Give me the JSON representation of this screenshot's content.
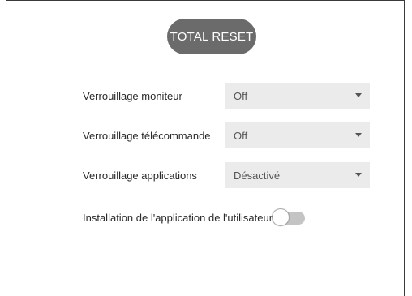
{
  "reset_button": {
    "label": "TOTAL RESET"
  },
  "settings": [
    {
      "label": "Verrouillage moniteur",
      "value": "Off"
    },
    {
      "label": "Verrouillage télécommande",
      "value": "Off"
    },
    {
      "label": "Verrouillage applications",
      "value": "Désactivé"
    }
  ],
  "user_app_install": {
    "label": "Installation de l'application de l'utilisateur",
    "enabled": false
  },
  "colors": {
    "button_bg": "#6b6b6b",
    "select_bg": "#ebebeb",
    "toggle_track": "#c4c4c4"
  },
  "icons": {
    "dropdown": "caret-down-icon"
  }
}
